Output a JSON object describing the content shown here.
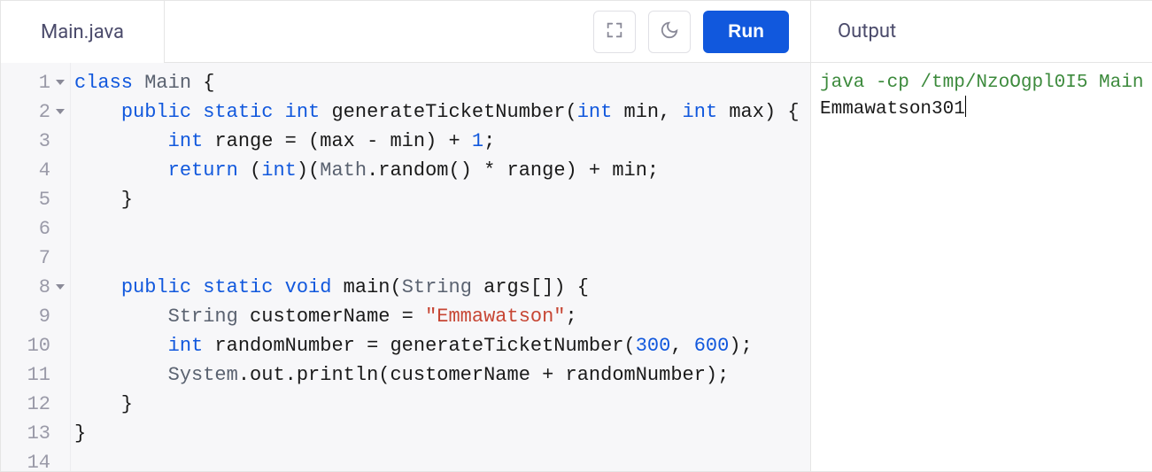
{
  "tab": {
    "filename": "Main.java"
  },
  "toolbar": {
    "fullscreen_icon": "fullscreen-icon",
    "theme_icon": "moon-icon",
    "run_label": "Run"
  },
  "editor": {
    "line_numbers": [
      "1",
      "2",
      "3",
      "4",
      "5",
      "6",
      "7",
      "8",
      "9",
      "10",
      "11",
      "12",
      "13",
      "14"
    ],
    "fold_lines": [
      1,
      2,
      8
    ],
    "code_lines": [
      {
        "indent": 0,
        "tokens": [
          {
            "t": "kw",
            "v": "class"
          },
          {
            "t": "sp",
            "v": " "
          },
          {
            "t": "ident",
            "v": "Main"
          },
          {
            "t": "sp",
            "v": " "
          },
          {
            "t": "punct",
            "v": "{"
          }
        ]
      },
      {
        "indent": 1,
        "tokens": [
          {
            "t": "kw",
            "v": "public"
          },
          {
            "t": "sp",
            "v": " "
          },
          {
            "t": "kw",
            "v": "static"
          },
          {
            "t": "sp",
            "v": " "
          },
          {
            "t": "kw",
            "v": "int"
          },
          {
            "t": "sp",
            "v": " "
          },
          {
            "t": "plain",
            "v": "generateTicketNumber("
          },
          {
            "t": "kw",
            "v": "int"
          },
          {
            "t": "sp",
            "v": " "
          },
          {
            "t": "plain",
            "v": "min, "
          },
          {
            "t": "kw",
            "v": "int"
          },
          {
            "t": "sp",
            "v": " "
          },
          {
            "t": "plain",
            "v": "max) {"
          }
        ]
      },
      {
        "indent": 2,
        "tokens": [
          {
            "t": "kw",
            "v": "int"
          },
          {
            "t": "sp",
            "v": " "
          },
          {
            "t": "plain",
            "v": "range = (max - min) + "
          },
          {
            "t": "num",
            "v": "1"
          },
          {
            "t": "plain",
            "v": ";"
          }
        ]
      },
      {
        "indent": 2,
        "tokens": [
          {
            "t": "kw",
            "v": "return"
          },
          {
            "t": "sp",
            "v": " "
          },
          {
            "t": "plain",
            "v": "("
          },
          {
            "t": "kw",
            "v": "int"
          },
          {
            "t": "plain",
            "v": ")("
          },
          {
            "t": "ident",
            "v": "Math"
          },
          {
            "t": "plain",
            "v": ".random() * range) + min;"
          }
        ]
      },
      {
        "indent": 1,
        "tokens": [
          {
            "t": "plain",
            "v": "}"
          }
        ]
      },
      {
        "indent": 0,
        "tokens": []
      },
      {
        "indent": 0,
        "tokens": []
      },
      {
        "indent": 1,
        "tokens": [
          {
            "t": "kw",
            "v": "public"
          },
          {
            "t": "sp",
            "v": " "
          },
          {
            "t": "kw",
            "v": "static"
          },
          {
            "t": "sp",
            "v": " "
          },
          {
            "t": "kw",
            "v": "void"
          },
          {
            "t": "sp",
            "v": " "
          },
          {
            "t": "plain",
            "v": "main("
          },
          {
            "t": "ident",
            "v": "String"
          },
          {
            "t": "sp",
            "v": " "
          },
          {
            "t": "plain",
            "v": "args[]) {"
          }
        ]
      },
      {
        "indent": 2,
        "tokens": [
          {
            "t": "ident",
            "v": "String"
          },
          {
            "t": "sp",
            "v": " "
          },
          {
            "t": "plain",
            "v": "customerName = "
          },
          {
            "t": "str",
            "v": "\"Emmawatson\""
          },
          {
            "t": "plain",
            "v": ";"
          }
        ]
      },
      {
        "indent": 2,
        "tokens": [
          {
            "t": "kw",
            "v": "int"
          },
          {
            "t": "sp",
            "v": " "
          },
          {
            "t": "plain",
            "v": "randomNumber = generateTicketNumber("
          },
          {
            "t": "num",
            "v": "300"
          },
          {
            "t": "plain",
            "v": ", "
          },
          {
            "t": "num",
            "v": "600"
          },
          {
            "t": "plain",
            "v": ");"
          }
        ]
      },
      {
        "indent": 2,
        "tokens": [
          {
            "t": "ident",
            "v": "System"
          },
          {
            "t": "plain",
            "v": ".out.println(customerName + randomNumber);"
          }
        ]
      },
      {
        "indent": 1,
        "tokens": [
          {
            "t": "plain",
            "v": "}"
          }
        ]
      },
      {
        "indent": 0,
        "tokens": [
          {
            "t": "plain",
            "v": "}"
          }
        ]
      },
      {
        "indent": 0,
        "tokens": []
      }
    ]
  },
  "output": {
    "title": "Output",
    "command": "java -cp /tmp/NzoOgpl0I5 Main",
    "result": "Emmawatson301"
  }
}
